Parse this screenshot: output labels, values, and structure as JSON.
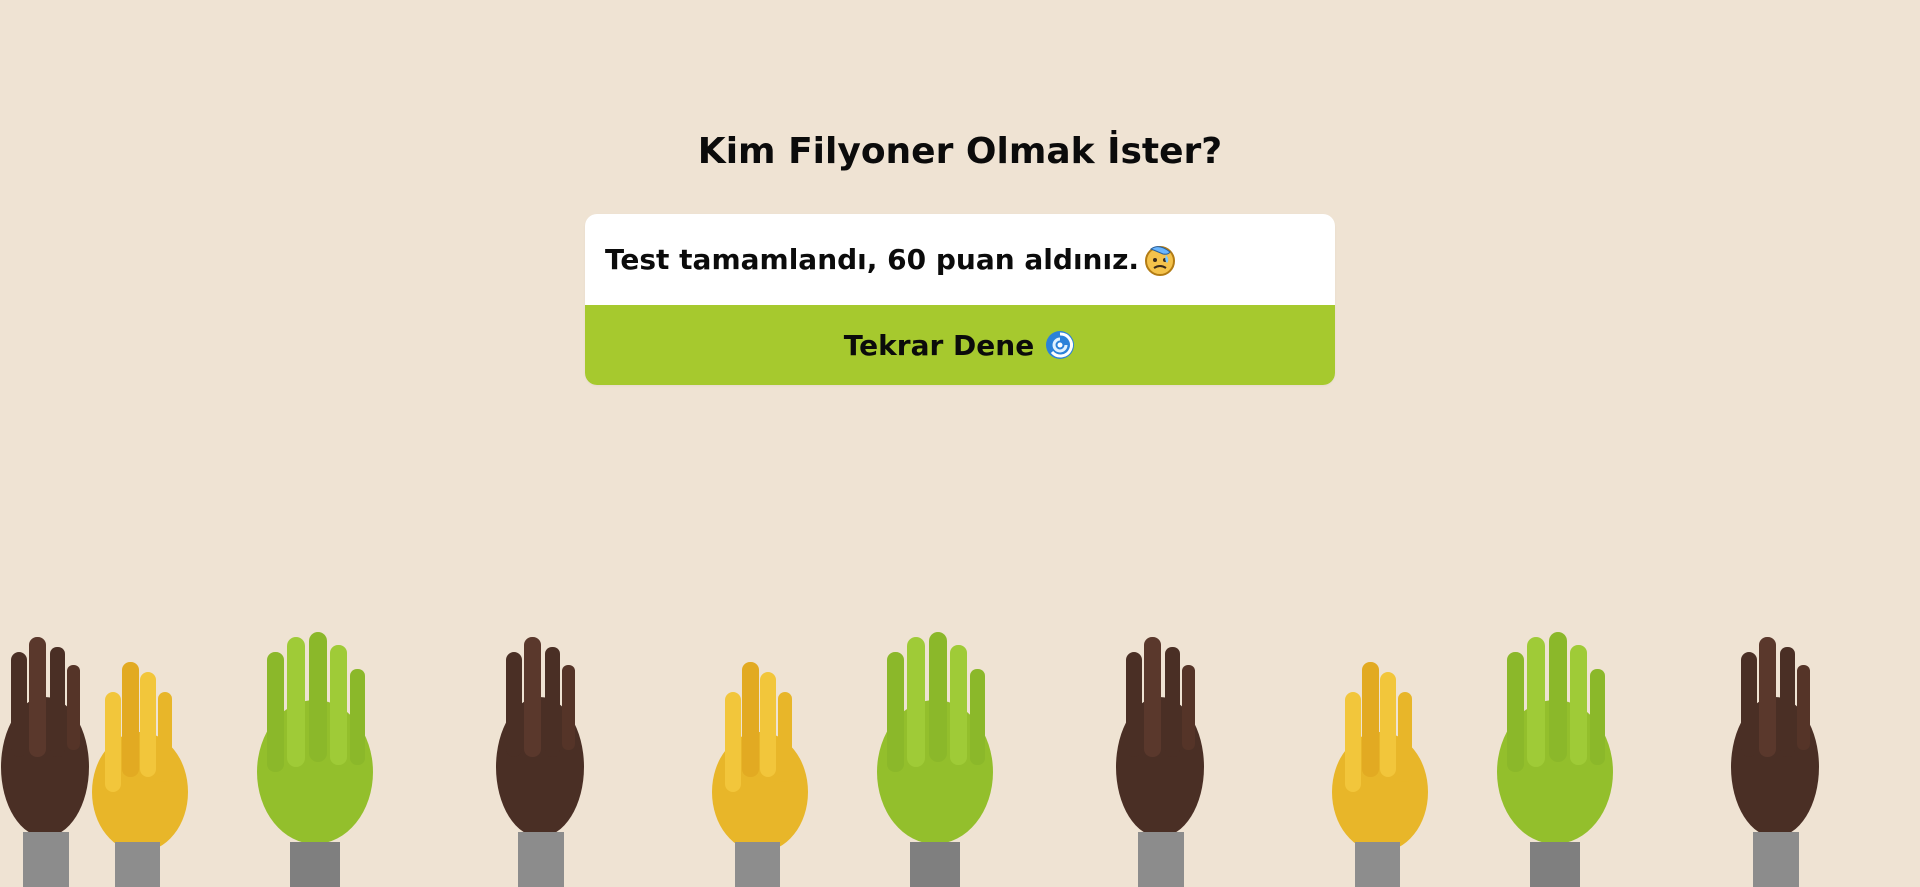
{
  "page": {
    "title": "Kim Filyoner Olmak İster?"
  },
  "result": {
    "message": "Test tamamlandı, 60 puan aldınız.",
    "emoji": "sad-relieved-face-icon"
  },
  "actions": {
    "retry_label": "Tekrar Dene",
    "retry_icon": "cyclone-icon"
  },
  "colors": {
    "background": "#efe3d3",
    "card": "#ffffff",
    "button": "#a6c92e",
    "dark_hand": "#4a2f25",
    "yellow_hand": "#e8b629",
    "green_hand": "#93bf2c"
  },
  "decorations": {
    "hands_pattern": [
      "dark-hand-icon",
      "crossed-fingers-hand-icon",
      "green-clapping-hands-icon"
    ]
  }
}
